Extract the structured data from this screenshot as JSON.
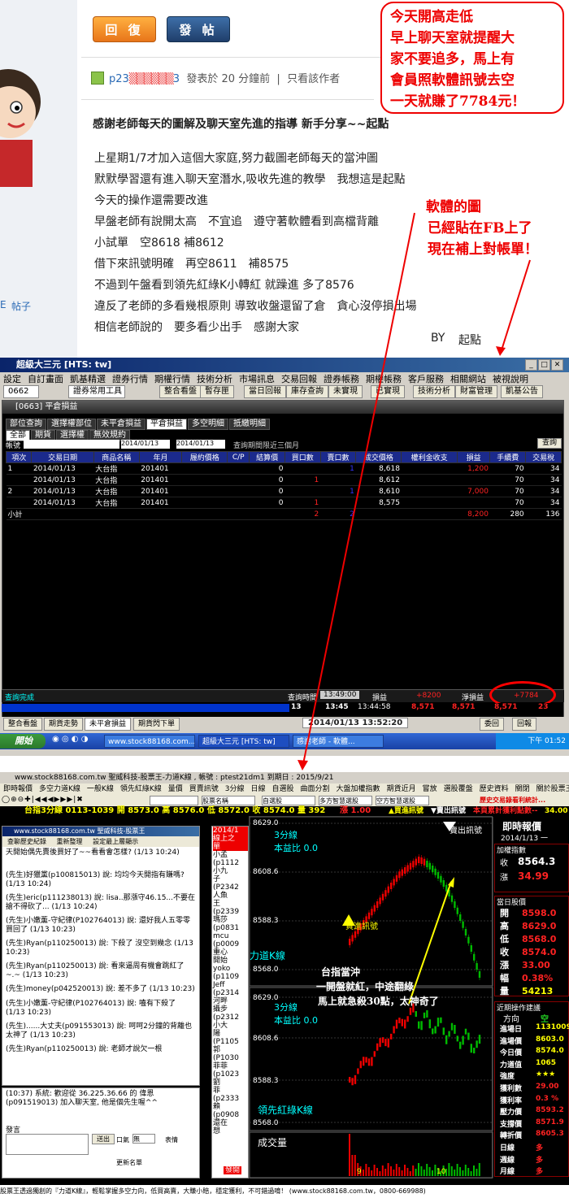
{
  "forum": {
    "reply_label": "回 復",
    "post_label": "發 帖",
    "user": "p23",
    "user_suffix": "3",
    "posted": "發表於 20 分鐘前",
    "sep": "|",
    "only_author": "只看該作者",
    "title": "感謝老師每天的圖解及聊天室先進的指導 新手分享~~起點",
    "lines": [
      "上星期1/7才加入這個大家庭,努力截圖老師每天的當沖圖",
      "默默學習還有進入聊天室潛水,吸收先進的教學　我想這是起點",
      "今天的操作還需要改進",
      "早盤老師有說開太高　不宜追　遵守著軟體看到高檔背離",
      "小試單　空8618 補8612",
      "借下來訊號明確　再空8611　補8575",
      "不過到午盤看到領先紅綠K小轉紅 就躁進 多了8576",
      "違反了老師的多看幾根原則 導致收盤還留了倉　貪心沒停損出場",
      "相信老師說的　要多看少出手　感謝大家"
    ],
    "by": "BY",
    "sign": "起點",
    "left_link": "帖子",
    "left_link2": "E",
    "annot1": [
      "今天開高走低",
      "早上聊天室就提醒大",
      "家不要追多，馬上有",
      "會員照軟體訊號去空",
      "一天就賺了7784元！"
    ],
    "annot2": [
      "軟體的圖",
      "已經貼在FB上了",
      "現在補上對帳單！"
    ]
  },
  "win1": {
    "title": "超級大三元 [HTS: tw]",
    "menu": [
      "設定",
      "自訂畫面",
      "凱基精選",
      "證券行情",
      "期權行情",
      "技術分析",
      "市場訊息",
      "交易回報",
      "證券帳務",
      "期權帳務",
      "客戶服務",
      "相關網站",
      "被視說明"
    ],
    "tb_code": "0662",
    "tb_combo": "證券常用工具",
    "tb_buttons": [
      "整合看盤",
      "暫存匣",
      "當日回報",
      "庫存查詢",
      "未實現",
      "已實現",
      "技術分析",
      "財富管理",
      "凱基公告"
    ],
    "inner_title": "[0663] 平倉損益",
    "tabs": [
      "部位查詢",
      "選擇權部位",
      "未平倉損益",
      "平倉損益",
      "多空明細",
      "抵繳明細"
    ],
    "subtabs": [
      "全部",
      "期貨",
      "選擇權",
      "無效規約"
    ],
    "acct_label": "帳號",
    "date_from": "2014/01/13",
    "date_to": "2014/01/13",
    "range_hint": "查詢期間限近三個月",
    "query_btn": "查詢",
    "headers": [
      "項次",
      "交易日期",
      "商品名稱",
      "年月",
      "履約價格",
      "C/P",
      "結算價",
      "買口數",
      "賣口數",
      "成交價格",
      "權利金收支",
      "損益",
      "手續費",
      "交易稅"
    ],
    "rows": [
      [
        "1",
        "2014/01/13",
        "大台指",
        "201401",
        "",
        "",
        "0",
        "",
        "1",
        "8,618",
        "",
        "1,200",
        "70",
        "34"
      ],
      [
        "",
        "2014/01/13",
        "大台指",
        "201401",
        "",
        "",
        "0",
        "1",
        "",
        "8,612",
        "",
        "",
        "70",
        "34"
      ],
      [
        "2",
        "2014/01/13",
        "大台指",
        "201401",
        "",
        "",
        "0",
        "",
        "1",
        "8,610",
        "",
        "7,000",
        "70",
        "34"
      ],
      [
        "",
        "2014/01/13",
        "大台指",
        "201401",
        "",
        "",
        "0",
        "1",
        "",
        "8,575",
        "",
        "",
        "70",
        "34"
      ]
    ],
    "subtotal": {
      "label": "小計",
      "buy": "2",
      "sell": "2",
      "pnl": "8,200",
      "fee": "280",
      "tax": "136"
    },
    "status_done": "查詢完成",
    "query_time_label": "查詢時間",
    "query_time": "13:49:00",
    "pnl_label": "損益",
    "pnl": "+8200",
    "net_label": "淨損益",
    "net": "+7784",
    "ticker": [
      "13",
      "13:45",
      "13:44:58",
      "8,571",
      "8,571",
      "8,571",
      "23"
    ],
    "bottom_tabs": [
      "整合看盤",
      "期貨走勢",
      "未平倉損益",
      "期貨閃下單"
    ],
    "clock": "2014/01/13 13:52:20",
    "bottom_right": [
      "委回",
      "回報"
    ],
    "task_start": "開始",
    "tasks": [
      "www.stock88168.com...",
      "超級大三元 [HTS: tw]",
      "感謝老師 - 軟體..."
    ],
    "task_time": "下午 01:52"
  },
  "win2": {
    "title": "www.stock88168.com.tw 聖威科技-股票王-力道K線 , 帳號 : ptest21dm1 到期日 : 2015/9/21",
    "menu": [
      "即時報價",
      "多空力道K線",
      "一般K線",
      "領先紅綠K線",
      "量價",
      "買賣訊號",
      "3分線",
      "日線",
      "自選股",
      "曲面分割",
      "大盤加權指數",
      "期貨近月",
      "嘗放",
      "選股覆盤",
      "歷史資料",
      "關閉",
      "關於股票王"
    ],
    "tb_fields": [
      "股票名稱",
      "自選股",
      "多方智慧選股",
      "空方智慧選股"
    ],
    "tb_link": "歷史交易錄看利統計...",
    "quote_bar": "台指3分線  0113-1039 開 8573.0 高 8576.0 低 8572.0 收 8574.0 量 392",
    "limit": "漲 1.00",
    "buy_sig": "▲買進訊號",
    "sell_sig": "▼賣出訊號",
    "profit_label": "本頁累計獲利點數--",
    "profit_val": "34.00",
    "chat_title": "www.stock88168.com.tw 聖威科技-股票王",
    "chat_btns": [
      "查聊歷史紀錄",
      "重新整理",
      "設定最上層顯示"
    ],
    "chat_msgs": [
      "天開始偶先賣後買好了~~看看會怎樣? (1/13 10:24)",
      "(先生)好獵黨(p100815013) 說: 均均今天開指有賺嗎? (1/13 10:24)",
      "(先生)eric(p111238013) 說: lisa..那漲守46.15...不要在搶不得砍了... (1/13 10:24)",
      "(先生)小嫩薰-守紀律(P102764013) 說: 還好我人五零零買回了 (1/13 10:23)",
      "(先生)Ryan(p110250013) 說: 下殺了 沒空到幾念 (1/13 10:23)",
      "(先生)Ryan(p110250013) 說: 看來逼周有機會跳紅了~.~ (1/13 10:23)",
      "(先生)money(p042520013) 說: 差不多了 (1/13 10:23)",
      "(先生)小嫩薰-守紀律(P102764013) 說: 嗑有下殺了 (1/13 10:23)",
      "(先生)......大丈夫(p091553013) 說: 呵呵2分鐘的背離也太神了 (1/13 10:23)",
      "(先生)Ryan(p110250013) 說: 老師才說欠一根"
    ],
    "sys_msg": "(10:37) 系統: 歡迎從 36.225.36.66 的 偉恩(p091519013) 加入聊天室, 他是個先生喔^^",
    "say_label": "發言",
    "send_btn": "送出",
    "private_label": "口氣",
    "private_val": "無",
    "emoji_label": "表情",
    "refresh": "更新名單",
    "mid_top": [
      "2014/1",
      "線上之",
      "單"
    ],
    "mid_names": [
      "小孟",
      "(p1112",
      "小九",
      "子",
      "(P2342",
      "人魚",
      "王",
      "(p2339",
      "瑪莎",
      "(p0831",
      "mcu",
      "(p0009",
      "重心",
      "開始",
      "yoko",
      "(p1109",
      "Jeff",
      "(p2314",
      "河畔",
      "攝步",
      "(p2312",
      "小大",
      "陽",
      "(P1105",
      "郭",
      "(P1030",
      "菲菲",
      "(p1023",
      "劉",
      "菲",
      "(p2333",
      "賴",
      "(p0908",
      "還在",
      "想"
    ],
    "mid_btn": "發開",
    "upper": {
      "axis": [
        "8629.0",
        "8608.6",
        "8588.3",
        "8568.0"
      ],
      "title": "3分線",
      "sub": "本益比 0.0",
      "name": "力道K線",
      "buy_label": "買進訊號",
      "sell_label": "賣出訊號"
    },
    "lower": {
      "axis": [
        "8629.0",
        "8608.6",
        "8588.3",
        "8568.0"
      ],
      "title": "3分線",
      "sub": "本益比 0.0",
      "name": "領先紅綠K線"
    },
    "vol_label": "成交量",
    "x_ticks": [
      "9",
      "10"
    ],
    "chart_annot": [
      "台指當沖",
      "一開盤就紅，中途翻綠",
      "馬上就急殺30點，太神奇了"
    ],
    "rp": {
      "title": "即時報價",
      "date": "2014/1/13 一",
      "idx_title": "加權指數",
      "idx_close_label": "收",
      "idx_close": "8564.3",
      "idx_chg_label": "漲",
      "idx_chg": "34.99",
      "day_title": "當日股價",
      "day": [
        [
          "開",
          "8598.0"
        ],
        [
          "高",
          "8629.0"
        ],
        [
          "低",
          "8568.0"
        ],
        [
          "收",
          "8574.0"
        ],
        [
          "漲",
          "33.00"
        ],
        [
          "幅",
          "0.38%"
        ],
        [
          "量",
          "54213"
        ]
      ],
      "recent_title": "近期操作建議",
      "dir_label": "方向",
      "dir": "空",
      "recent": [
        [
          "進場日",
          "1131009"
        ],
        [
          "進場價",
          "8603.0"
        ],
        [
          "今日價",
          "8574.0"
        ],
        [
          "力道值",
          "1065"
        ],
        [
          "強度",
          "★★★"
        ],
        [
          "獲利數",
          "29.00"
        ],
        [
          "獲利率",
          "0.3 %"
        ],
        [
          "壓力價",
          "8593.2"
        ],
        [
          "支撐價",
          "8571.9"
        ],
        [
          "轉折價",
          "8605.3"
        ],
        [
          "日線",
          "多"
        ],
        [
          "週線",
          "多"
        ],
        [
          "月線",
          "多"
        ]
      ]
    },
    "footer": "股票王透過獨創的『力道K線』，輕鬆掌握多空力向，低買高賣，大賺小賠，穩定獲利，不可錯過唷！ (www.stock88168.com.tw，0800-669988)"
  },
  "chart_data": [
    {
      "type": "bar",
      "title": "3分線",
      "series": [
        {
          "name": "力道K線",
          "color": "#e00 / #0a0"
        }
      ],
      "ylim": [
        8568.0,
        8629.0
      ],
      "ticks": [
        8629.0,
        8608.6,
        8588.3,
        8568.0
      ]
    },
    {
      "type": "bar",
      "title": "3分線",
      "series": [
        {
          "name": "領先紅綠K線"
        }
      ],
      "ylim": [
        8568.0,
        8629.0
      ],
      "ticks": [
        8629.0,
        8608.6,
        8588.3,
        8568.0
      ]
    },
    {
      "type": "bar",
      "title": "成交量",
      "x_ticks": [
        "9",
        "10"
      ]
    }
  ],
  "colors": {
    "accent_red": "#e00000",
    "taskbar_blue": "#245edb",
    "header_blue": "#1b2a8c"
  }
}
